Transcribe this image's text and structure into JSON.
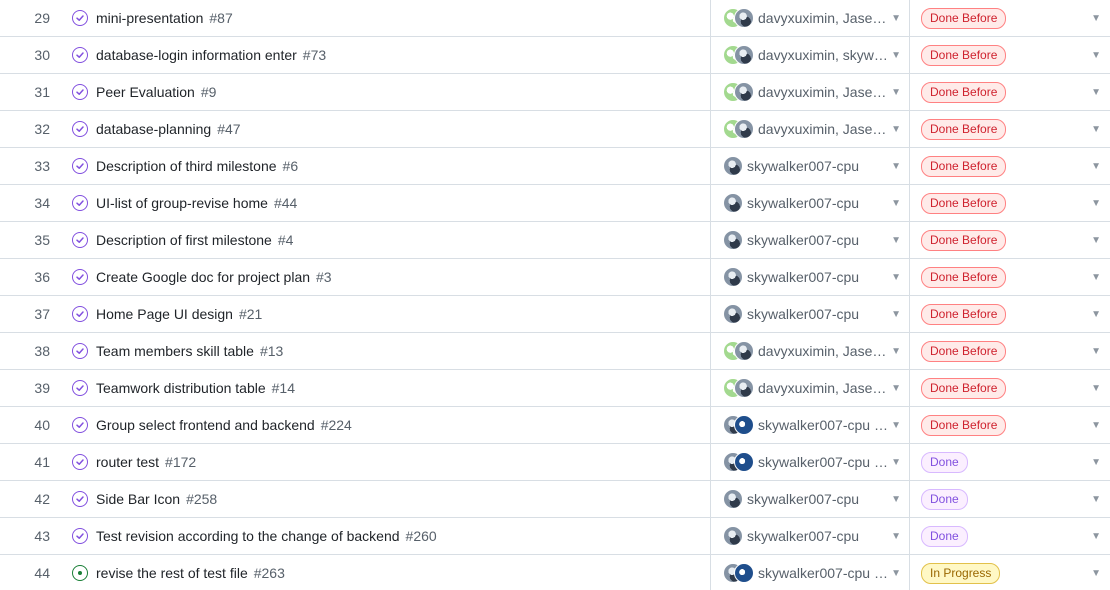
{
  "rows": [
    {
      "num": "29",
      "title": "mini-presentation",
      "issue": "#87",
      "state": "closed",
      "avatars": [
        "green",
        "gray"
      ],
      "assignees": "davyxuximin, Jases...",
      "status": "Done Before",
      "status_kind": "done-before"
    },
    {
      "num": "30",
      "title": "database-login information enter",
      "issue": "#73",
      "state": "closed",
      "avatars": [
        "green",
        "gray"
      ],
      "assignees": "davyxuximin, skywa...",
      "status": "Done Before",
      "status_kind": "done-before"
    },
    {
      "num": "31",
      "title": "Peer Evaluation",
      "issue": "#9",
      "state": "closed",
      "avatars": [
        "green",
        "gray"
      ],
      "assignees": "davyxuximin, Jases...",
      "status": "Done Before",
      "status_kind": "done-before"
    },
    {
      "num": "32",
      "title": "database-planning",
      "issue": "#47",
      "state": "closed",
      "avatars": [
        "green",
        "gray"
      ],
      "assignees": "davyxuximin, Jases...",
      "status": "Done Before",
      "status_kind": "done-before"
    },
    {
      "num": "33",
      "title": "Description of third milestone",
      "issue": "#6",
      "state": "closed",
      "avatars": [
        "gray"
      ],
      "assignees": "skywalker007-cpu",
      "status": "Done Before",
      "status_kind": "done-before"
    },
    {
      "num": "34",
      "title": "UI-list of group-revise home",
      "issue": "#44",
      "state": "closed",
      "avatars": [
        "gray"
      ],
      "assignees": "skywalker007-cpu",
      "status": "Done Before",
      "status_kind": "done-before"
    },
    {
      "num": "35",
      "title": "Description of first milestone",
      "issue": "#4",
      "state": "closed",
      "avatars": [
        "gray"
      ],
      "assignees": "skywalker007-cpu",
      "status": "Done Before",
      "status_kind": "done-before"
    },
    {
      "num": "36",
      "title": "Create Google doc for project plan",
      "issue": "#3",
      "state": "closed",
      "avatars": [
        "gray"
      ],
      "assignees": "skywalker007-cpu",
      "status": "Done Before",
      "status_kind": "done-before"
    },
    {
      "num": "37",
      "title": "Home Page UI design",
      "issue": "#21",
      "state": "closed",
      "avatars": [
        "gray"
      ],
      "assignees": "skywalker007-cpu",
      "status": "Done Before",
      "status_kind": "done-before"
    },
    {
      "num": "38",
      "title": "Team members skill table",
      "issue": "#13",
      "state": "closed",
      "avatars": [
        "green",
        "gray"
      ],
      "assignees": "davyxuximin, Jases...",
      "status": "Done Before",
      "status_kind": "done-before"
    },
    {
      "num": "39",
      "title": "Teamwork distribution table",
      "issue": "#14",
      "state": "closed",
      "avatars": [
        "green",
        "gray"
      ],
      "assignees": "davyxuximin, Jases...",
      "status": "Done Before",
      "status_kind": "done-before"
    },
    {
      "num": "40",
      "title": "Group select frontend and backend",
      "issue": "#224",
      "state": "closed",
      "avatars": [
        "gray",
        "blue"
      ],
      "assignees": "skywalker007-cpu a...",
      "status": "Done Before",
      "status_kind": "done-before"
    },
    {
      "num": "41",
      "title": "router test",
      "issue": "#172",
      "state": "closed",
      "avatars": [
        "gray",
        "blue"
      ],
      "assignees": "skywalker007-cpu a...",
      "status": "Done",
      "status_kind": "done"
    },
    {
      "num": "42",
      "title": "Side Bar Icon",
      "issue": "#258",
      "state": "closed",
      "avatars": [
        "gray"
      ],
      "assignees": "skywalker007-cpu",
      "status": "Done",
      "status_kind": "done"
    },
    {
      "num": "43",
      "title": "Test revision according to the change of backend",
      "issue": "#260",
      "state": "closed",
      "avatars": [
        "gray"
      ],
      "assignees": "skywalker007-cpu",
      "status": "Done",
      "status_kind": "done"
    },
    {
      "num": "44",
      "title": "revise the rest of test file",
      "issue": "#263",
      "state": "open",
      "avatars": [
        "gray",
        "blue"
      ],
      "assignees": "skywalker007-cpu a...",
      "status": "In Progress",
      "status_kind": "in-progress"
    }
  ],
  "icons": {
    "closed": "check-circle-icon",
    "open": "open-issue-icon",
    "dropdown": "caret-down-icon"
  },
  "colors": {
    "done_before": "#cf222e",
    "done": "#8250df",
    "in_progress": "#9a6700",
    "closed_icon": "#8250df",
    "open_icon": "#1a7f37"
  }
}
